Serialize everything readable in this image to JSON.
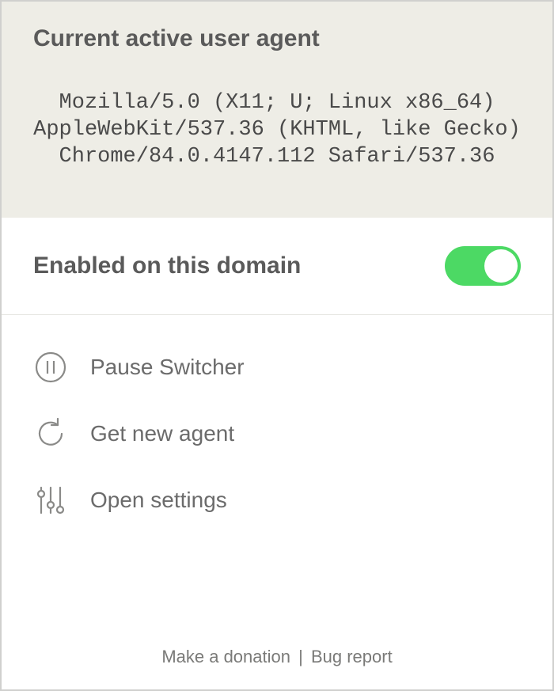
{
  "header": {
    "title": "Current active user agent",
    "user_agent": "Mozilla/5.0 (X11; U; Linux x86_64) AppleWebKit/537.36 (KHTML, like Gecko) Chrome/84.0.4147.112 Safari/537.36"
  },
  "domain_toggle": {
    "label": "Enabled on this domain",
    "enabled": true,
    "on_color": "#4cd964"
  },
  "menu": {
    "pause": {
      "label": "Pause Switcher",
      "icon": "pause-icon"
    },
    "refresh": {
      "label": "Get new agent",
      "icon": "refresh-icon"
    },
    "settings": {
      "label": "Open settings",
      "icon": "sliders-icon"
    }
  },
  "footer": {
    "donate": "Make a donation",
    "separator": "|",
    "bug": "Bug report"
  }
}
